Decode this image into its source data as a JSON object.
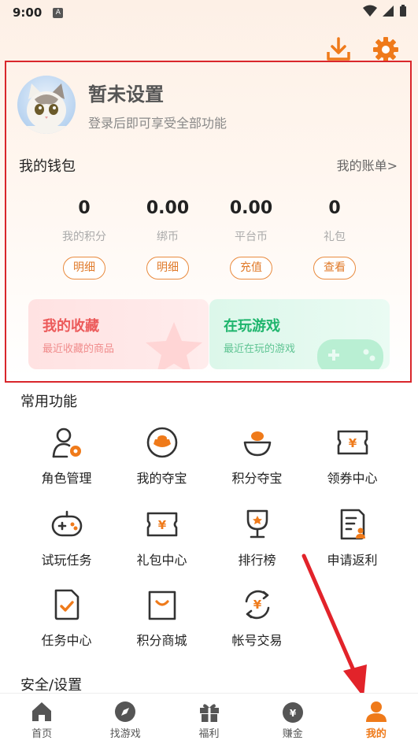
{
  "status_bar": {
    "time": "9:00",
    "badge": "A"
  },
  "profile": {
    "name": "暂未设置",
    "subtitle": "登录后即可享受全部功能"
  },
  "wallet": {
    "title": "我的钱包",
    "bill_link": "我的账单>",
    "columns": [
      {
        "value": "0",
        "label": "我的积分",
        "button": "明细"
      },
      {
        "value": "0.00",
        "label": "绑币",
        "button": "明细"
      },
      {
        "value": "0.00",
        "label": "平台币",
        "button": "充值"
      },
      {
        "value": "0",
        "label": "礼包",
        "button": "查看"
      }
    ]
  },
  "cards": {
    "favorites": {
      "title": "我的收藏",
      "subtitle": "最近收藏的商品"
    },
    "playing": {
      "title": "在玩游戏",
      "subtitle": "最近在玩的游戏"
    }
  },
  "common": {
    "title": "常用功能",
    "items": [
      {
        "label": "角色管理",
        "icon": "role-manage-icon"
      },
      {
        "label": "我的夺宝",
        "icon": "treasure-icon"
      },
      {
        "label": "积分夺宝",
        "icon": "points-treasure-icon"
      },
      {
        "label": "领券中心",
        "icon": "coupon-icon"
      },
      {
        "label": "试玩任务",
        "icon": "gamepad-icon"
      },
      {
        "label": "礼包中心",
        "icon": "gift-ticket-icon"
      },
      {
        "label": "排行榜",
        "icon": "trophy-icon"
      },
      {
        "label": "申请返利",
        "icon": "rebate-doc-icon"
      },
      {
        "label": "任务中心",
        "icon": "task-icon"
      },
      {
        "label": "积分商城",
        "icon": "shopping-bag-icon"
      },
      {
        "label": "帐号交易",
        "icon": "account-trade-icon"
      }
    ]
  },
  "security": {
    "title": "安全/设置"
  },
  "bottom_nav": [
    {
      "label": "首页",
      "icon": "home-icon"
    },
    {
      "label": "找游戏",
      "icon": "compass-icon"
    },
    {
      "label": "福利",
      "icon": "gift-icon"
    },
    {
      "label": "赚金",
      "icon": "money-bag-icon"
    },
    {
      "label": "我的",
      "icon": "user-icon",
      "active": true
    }
  ],
  "colors": {
    "accent": "#ef7a1a",
    "highlight_border": "#d9262b"
  }
}
